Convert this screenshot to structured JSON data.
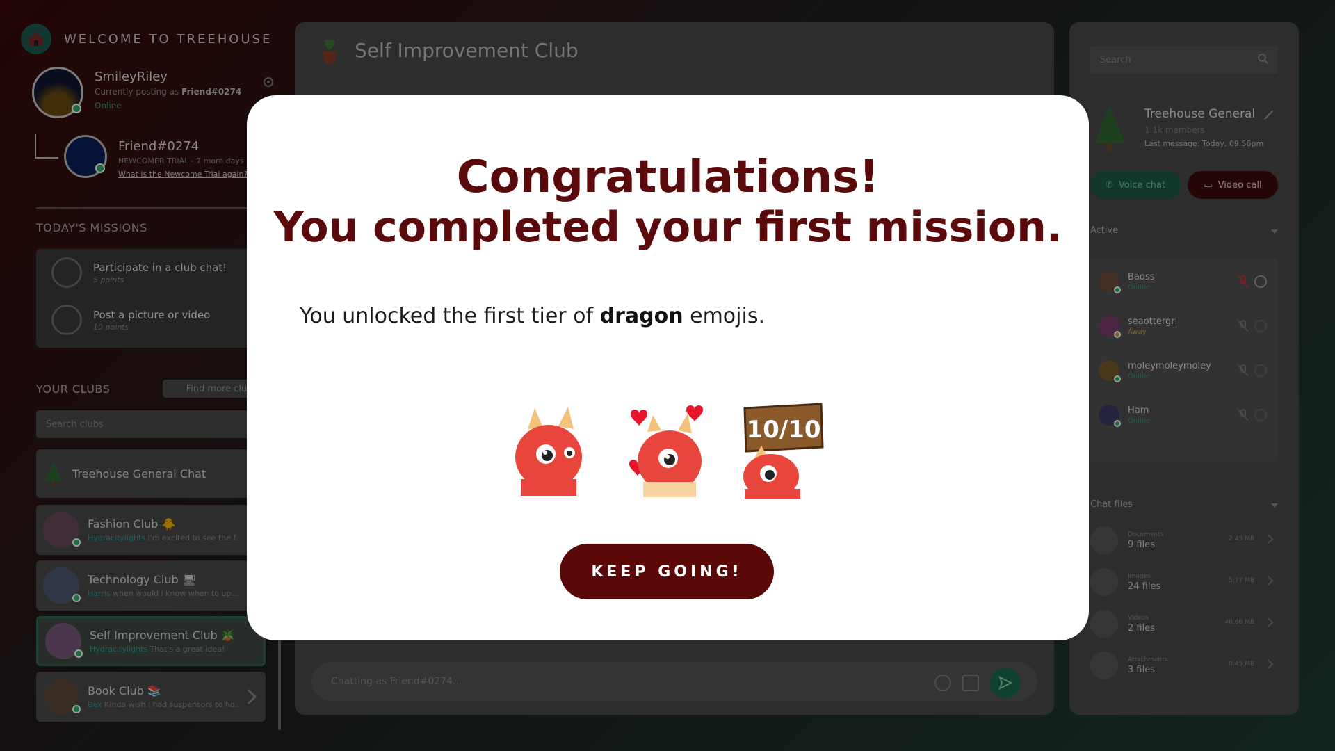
{
  "brand": {
    "title": "WELCOME TO TREEHOUSE"
  },
  "user": {
    "name": "SmileyRiley",
    "posting_prefix": "Currently posting as",
    "posting_as": "Friend#0274",
    "status": "Online"
  },
  "friend": {
    "name": "Friend#0274",
    "trial": "NEWCOMER TRIAL - 7 more days",
    "link": "What is the Newcome Trial again?"
  },
  "missions": {
    "heading": "TODAY'S MISSIONS",
    "items": [
      {
        "title": "Participate in a club chat!",
        "points": "5 points"
      },
      {
        "title": "Post a picture or video",
        "points": "10 points"
      }
    ]
  },
  "clubs": {
    "heading": "YOUR CLUBS",
    "find_more": "Find more clubs",
    "search_placeholder": "Search clubs",
    "items": [
      {
        "name": "Treehouse General Chat",
        "author": "",
        "last": ""
      },
      {
        "name": "Fashion Club 🐥",
        "author": "Hydracitylights",
        "last": "I'm excited to see the f..."
      },
      {
        "name": "Technology Club 🖥",
        "author": "Harris",
        "last": "when would i know when to up..."
      },
      {
        "name": "Self Improvement Club 🪴",
        "author": "Hydracitylights",
        "last": "That's a great idea!"
      },
      {
        "name": "Book Club 📚",
        "author": "Bex",
        "last": "Kinda wish I had suspensors to ho..."
      }
    ]
  },
  "chat": {
    "title": "Self Improvement Club",
    "composer_placeholder": "Chatting as Friend#0274..."
  },
  "right": {
    "search_placeholder": "Search",
    "channel_title": "Treehouse General",
    "members": "1.1k members",
    "last_message": "Last message: Today, 09:56pm",
    "voice_label": "Voice chat",
    "video_label": "Video call",
    "active_heading": "Active",
    "members_list": [
      {
        "name": "Baoss",
        "status": "Online"
      },
      {
        "name": "seaottergrl",
        "status": "Away"
      },
      {
        "name": "moleymoleymoley",
        "status": "Online"
      },
      {
        "name": "Ham",
        "status": "Online"
      }
    ],
    "files_heading": "Chat files",
    "files": [
      {
        "label": "Documents",
        "count": "9 files",
        "size": "2.45 MB"
      },
      {
        "label": "Images",
        "count": "24 files",
        "size": "5.77 MB"
      },
      {
        "label": "Videos",
        "count": "2 files",
        "size": "46.66 MB"
      },
      {
        "label": "Attachments",
        "count": "3 files",
        "size": "0.45 MB"
      }
    ]
  },
  "modal": {
    "line1": "Congratulations!",
    "line2": "You completed your first mission.",
    "text_before": "You unlocked the first tier of ",
    "text_bold": "dragon",
    "text_after": " emojis.",
    "sign_text": "10/10",
    "button_label": "KEEP GOING!"
  },
  "colors": {
    "accent_maroon": "#5a0808",
    "accent_green": "#1d5b47",
    "online": "#2bb36a"
  }
}
